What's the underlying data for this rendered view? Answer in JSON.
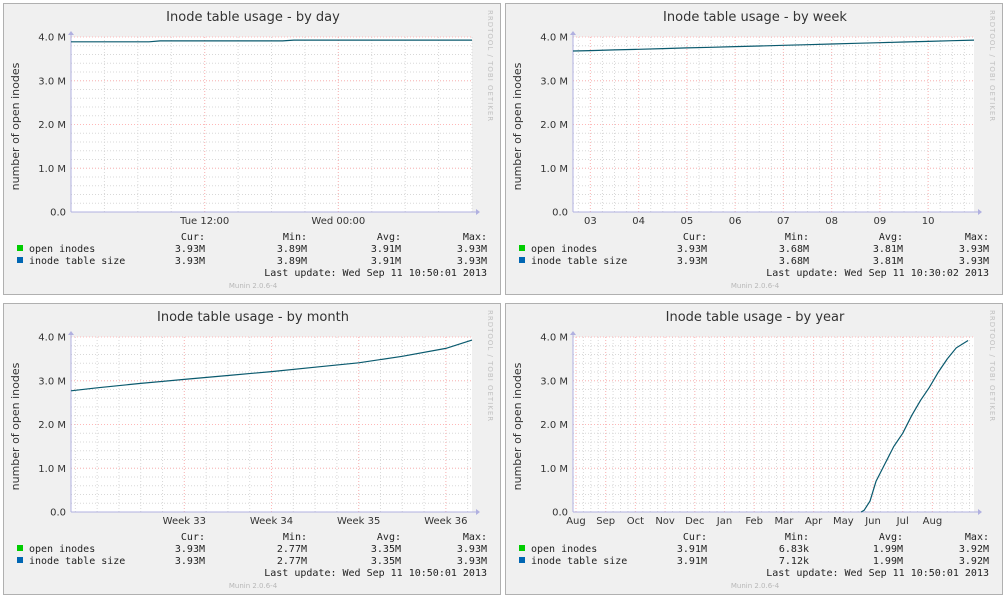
{
  "colors": {
    "panel_bg": "#f0f0f0",
    "grid_major": "#ffb8b8",
    "grid_minor": "#d8d8d8",
    "axis": "#b0b0e0",
    "series_open": "#00cc00",
    "series_size": "#0066b3",
    "line": "#0a5a6e"
  },
  "common": {
    "watermark": "RRDTOOL / TOBI OETIKER",
    "footer": "Munin 2.0.6-4",
    "stat_headers": [
      "Cur:",
      "Min:",
      "Avg:",
      "Max:"
    ]
  },
  "chart_data": [
    {
      "type": "line",
      "title": "Inode table usage - by day",
      "ylabel": "number of open inodes",
      "xlabel": "",
      "ylim": [
        0,
        4000000
      ],
      "y_ticks": [
        "0.0",
        "1.0 M",
        "2.0 M",
        "3.0 M",
        "4.0 M"
      ],
      "x_range": [
        0,
        36
      ],
      "x_ticks": [
        {
          "x": 12,
          "label": "Tue 12:00"
        },
        {
          "x": 24,
          "label": "Wed 00:00"
        }
      ],
      "series": [
        {
          "name": "open inodes",
          "cur": "3.93M",
          "min": "3.89M",
          "avg": "3.91M",
          "max": "3.93M"
        },
        {
          "name": "inode table size",
          "cur": "3.93M",
          "min": "3.89M",
          "avg": "3.91M",
          "max": "3.93M",
          "x": [
            0,
            7,
            8,
            19,
            20,
            31,
            32,
            36
          ],
          "y": [
            3890000,
            3890000,
            3910000,
            3910000,
            3930000,
            3930000,
            3930000,
            3930000
          ]
        }
      ],
      "last_update": "Last update:  Wed Sep 11 10:50:01 2013"
    },
    {
      "type": "line",
      "title": "Inode table usage - by week",
      "ylabel": "number of open inodes",
      "xlabel": "",
      "ylim": [
        0,
        4000000
      ],
      "y_ticks": [
        "0.0",
        "1.0 M",
        "2.0 M",
        "3.0 M",
        "4.0 M"
      ],
      "x_range": [
        2.64,
        10.95
      ],
      "x_ticks": [
        {
          "x": 3,
          "label": "03"
        },
        {
          "x": 4,
          "label": "04"
        },
        {
          "x": 5,
          "label": "05"
        },
        {
          "x": 6,
          "label": "06"
        },
        {
          "x": 7,
          "label": "07"
        },
        {
          "x": 8,
          "label": "08"
        },
        {
          "x": 9,
          "label": "09"
        },
        {
          "x": 10,
          "label": "10"
        }
      ],
      "series": [
        {
          "name": "open inodes",
          "cur": "3.93M",
          "min": "3.68M",
          "avg": "3.81M",
          "max": "3.93M"
        },
        {
          "name": "inode table size",
          "cur": "3.93M",
          "min": "3.68M",
          "avg": "3.81M",
          "max": "3.93M",
          "x": [
            2.64,
            3.0,
            3.5,
            4.0,
            4.5,
            5.0,
            5.5,
            6.0,
            6.5,
            7.0,
            7.5,
            8.0,
            8.5,
            9.0,
            9.5,
            10.0,
            10.5,
            10.95
          ],
          "y": [
            3680000,
            3690000,
            3705000,
            3720000,
            3735000,
            3750000,
            3765000,
            3780000,
            3795000,
            3810000,
            3825000,
            3840000,
            3855000,
            3870000,
            3885000,
            3900000,
            3915000,
            3930000
          ]
        }
      ],
      "last_update": "Last update:  Wed Sep 11 10:30:02 2013"
    },
    {
      "type": "line",
      "title": "Inode table usage - by month",
      "ylabel": "number of open inodes",
      "xlabel": "",
      "ylim": [
        0,
        4000000
      ],
      "y_ticks": [
        "0.0",
        "1.0 M",
        "2.0 M",
        "3.0 M",
        "4.0 M"
      ],
      "x_range": [
        31.7,
        36.3
      ],
      "x_ticks": [
        {
          "x": 33,
          "label": "Week 33"
        },
        {
          "x": 34,
          "label": "Week 34"
        },
        {
          "x": 35,
          "label": "Week 35"
        },
        {
          "x": 36,
          "label": "Week 36"
        }
      ],
      "series": [
        {
          "name": "open inodes",
          "cur": "3.93M",
          "min": "2.77M",
          "avg": "3.35M",
          "max": "3.93M"
        },
        {
          "name": "inode table size",
          "cur": "3.93M",
          "min": "2.77M",
          "avg": "3.35M",
          "max": "3.93M",
          "x": [
            31.7,
            32.0,
            32.5,
            33.0,
            33.5,
            34.0,
            34.5,
            35.0,
            35.5,
            36.0,
            36.3
          ],
          "y": [
            2770000,
            2840000,
            2940000,
            3030000,
            3120000,
            3210000,
            3310000,
            3410000,
            3560000,
            3740000,
            3930000
          ]
        }
      ],
      "last_update": "Last update:  Wed Sep 11 10:50:01 2013"
    },
    {
      "type": "line",
      "title": "Inode table usage - by year",
      "ylabel": "number of open inodes",
      "xlabel": "",
      "ylim": [
        0,
        4000000
      ],
      "y_ticks": [
        "0.0",
        "1.0 M",
        "2.0 M",
        "3.0 M",
        "4.0 M"
      ],
      "x_range": [
        -0.1,
        13.4
      ],
      "x_ticks": [
        {
          "x": 0,
          "label": "Aug"
        },
        {
          "x": 1,
          "label": "Sep"
        },
        {
          "x": 2,
          "label": "Oct"
        },
        {
          "x": 3,
          "label": "Nov"
        },
        {
          "x": 4,
          "label": "Dec"
        },
        {
          "x": 5,
          "label": "Jan"
        },
        {
          "x": 6,
          "label": "Feb"
        },
        {
          "x": 7,
          "label": "Mar"
        },
        {
          "x": 8,
          "label": "Apr"
        },
        {
          "x": 9,
          "label": "May"
        },
        {
          "x": 10,
          "label": "Jun"
        },
        {
          "x": 11,
          "label": "Jul"
        },
        {
          "x": 12,
          "label": "Aug"
        }
      ],
      "series": [
        {
          "name": "open inodes",
          "cur": "3.91M",
          "min": "6.83k",
          "avg": "1.99M",
          "max": "3.92M"
        },
        {
          "name": "inode table size",
          "cur": "3.91M",
          "min": "7.12k",
          "avg": "1.99M",
          "max": "3.92M",
          "x": [
            9.6,
            9.7,
            9.9,
            10.1,
            10.4,
            10.7,
            11.0,
            11.3,
            11.6,
            11.9,
            12.2,
            12.5,
            12.8,
            13.2
          ],
          "y": [
            0,
            40000,
            250000,
            700000,
            1100000,
            1500000,
            1800000,
            2200000,
            2550000,
            2850000,
            3200000,
            3500000,
            3750000,
            3920000
          ]
        }
      ],
      "last_update": "Last update:  Wed Sep 11 10:50:01 2013"
    }
  ]
}
